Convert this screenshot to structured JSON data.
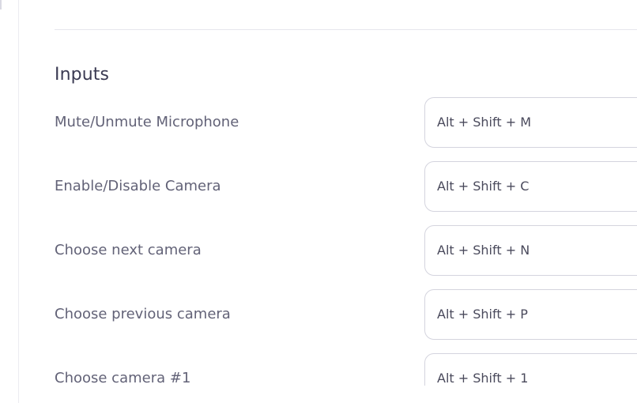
{
  "section": {
    "title": "Inputs"
  },
  "shortcuts": [
    {
      "label": "Mute/Unmute Microphone",
      "value": "Alt + Shift + M"
    },
    {
      "label": "Enable/Disable Camera",
      "value": "Alt + Shift + C"
    },
    {
      "label": "Choose next camera",
      "value": "Alt + Shift + N"
    },
    {
      "label": "Choose previous camera",
      "value": "Alt + Shift + P"
    },
    {
      "label": "Choose camera #1",
      "value": "Alt + Shift + 1"
    }
  ]
}
